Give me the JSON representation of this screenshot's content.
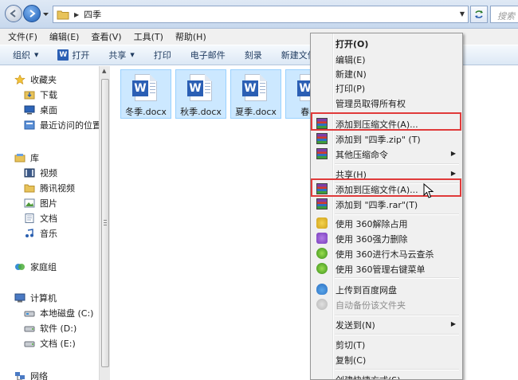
{
  "address": {
    "breadcrumb": "四季",
    "search_placeholder": "搜索"
  },
  "menubar": [
    "文件(F)",
    "编辑(E)",
    "查看(V)",
    "工具(T)",
    "帮助(H)"
  ],
  "toolbar": {
    "organize": "组织",
    "open": "打开",
    "share": "共享",
    "print": "打印",
    "email": "电子邮件",
    "burn": "刻录",
    "new_folder": "新建文件"
  },
  "sidebar": {
    "favorites": {
      "label": "收藏夹",
      "items": [
        "下载",
        "桌面",
        "最近访问的位置"
      ]
    },
    "libraries": {
      "label": "库",
      "items": [
        "视频",
        "腾讯视频",
        "图片",
        "文档",
        "音乐"
      ]
    },
    "homegroup": "家庭组",
    "computer": {
      "label": "计算机",
      "items": [
        "本地磁盘 (C:)",
        "软件 (D:)",
        "文档 (E:)"
      ]
    },
    "network": "网络"
  },
  "files": [
    "冬季.docx",
    "秋季.docx",
    "夏季.docx",
    "春季."
  ],
  "context_menu": {
    "open": "打开(O)",
    "edit": "编辑(E)",
    "new": "新建(N)",
    "print": "打印(P)",
    "admin": "管理员取得所有权",
    "add_archive_1": "添加到压缩文件(A)...",
    "add_zip": "添加到 \"四季.zip\" (T)",
    "other_compress": "其他压缩命令",
    "share": "共享(H)",
    "add_archive_2": "添加到压缩文件(A)...",
    "add_rar": "添加到 \"四季.rar\"(T)",
    "unlock_360": "使用 360解除占用",
    "force_delete_360": "使用 360强力删除",
    "trojan_scan_360": "使用 360进行木马云查杀",
    "manage_menu_360": "使用 360管理右键菜单",
    "upload_baidu": "上传到百度网盘",
    "auto_backup": "自动备份该文件夹",
    "send_to": "发送到(N)",
    "cut": "剪切(T)",
    "copy": "复制(C)",
    "create_shortcut": "创建快捷方式(S)"
  },
  "colors": {
    "highlight_box": "#e03a3a",
    "selection": "#cce8ff",
    "word_blue": "#2b5fb4"
  }
}
